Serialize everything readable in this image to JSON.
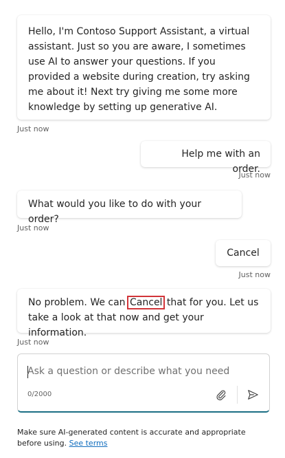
{
  "messages": [
    {
      "role": "bot",
      "text": "Hello, I'm Contoso Support Assistant, a virtual assistant. Just so you are aware, I sometimes use AI to answer your questions. If you provided a website during creation, try asking me about it! Next try giving me some more knowledge by setting up generative AI.",
      "time": "Just now"
    },
    {
      "role": "user",
      "text": "Help me with an order.",
      "time": "Just now"
    },
    {
      "role": "bot",
      "text": "What would you like to do with your order?",
      "time": "Just now"
    },
    {
      "role": "user",
      "text": "Cancel",
      "time": "Just now"
    },
    {
      "role": "bot",
      "text_before": "No problem. We can ",
      "highlight": "Cancel",
      "text_after": " that for you. Let us take a look at that now and get your information.",
      "time": "Just now"
    }
  ],
  "composer": {
    "placeholder": "Ask a question or describe what you need",
    "counter": "0/2000",
    "attach_icon": "paperclip-icon",
    "send_icon": "send-icon",
    "accent_color": "#1a6e84"
  },
  "disclaimer": {
    "text": "Make sure AI-generated content is accurate and appropriate before using. ",
    "link": "See terms"
  },
  "colors": {
    "highlight_border": "#d13438",
    "link": "#0f6cbd"
  }
}
